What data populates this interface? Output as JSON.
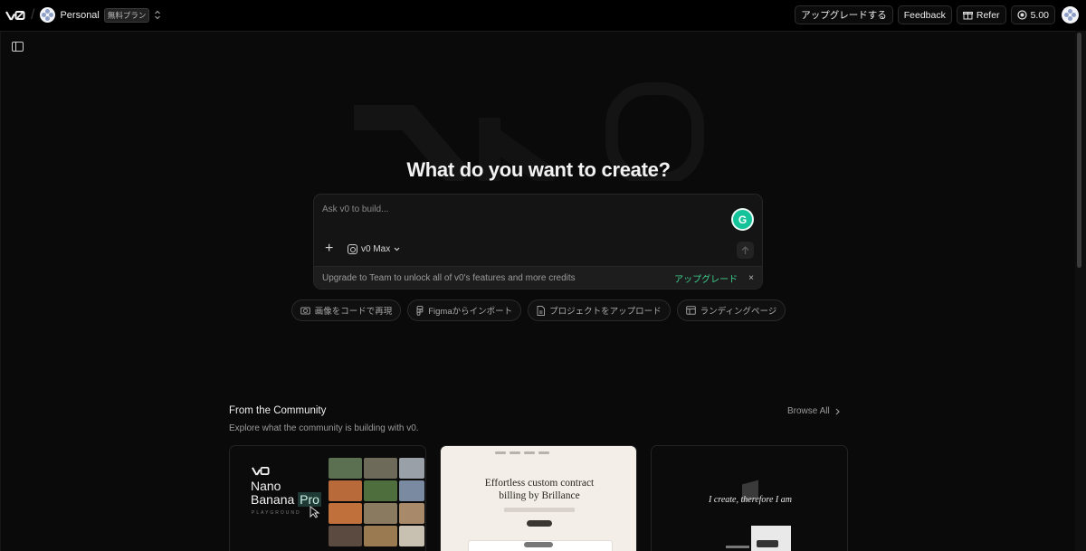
{
  "topbar": {
    "logo": "v0",
    "workspace_name": "Personal",
    "plan_badge": "無料プラン",
    "upgrade_button": "アップグレードする",
    "feedback_button": "Feedback",
    "refer_button": "Refer",
    "credits": "5.00"
  },
  "hero": {
    "title": "What do you want to create?"
  },
  "prompt": {
    "placeholder": "Ask v0 to build...",
    "model": "v0 Max",
    "upgrade_notice": "Upgrade to Team to unlock all of v0's features and more credits",
    "upgrade_link": "アップグレード",
    "dismiss": "×"
  },
  "quick_actions": [
    {
      "label": "画像をコードで再現",
      "icon": "camera-icon"
    },
    {
      "label": "Figmaからインポート",
      "icon": "figma-icon"
    },
    {
      "label": "プロジェクトをアップロード",
      "icon": "file-upload-icon"
    },
    {
      "label": "ランディングページ",
      "icon": "layout-icon"
    }
  ],
  "community": {
    "title": "From the Community",
    "subtitle": "Explore what the community is building with v0.",
    "browse_all": "Browse All",
    "cards": [
      {
        "logo": "v0",
        "title_line1": "Nano",
        "title_line2": "Banana",
        "title_highlight": "Pro",
        "subtitle": "PLAYGROUND"
      },
      {
        "headline_line1": "Effortless custom contract",
        "headline_line2": "billing by Brillance"
      },
      {
        "text": "I create, therefore I am"
      }
    ]
  },
  "colors": {
    "background": "#0a0a0a",
    "accent_green": "#3ecf8e",
    "grammarly": "#15c39a"
  }
}
